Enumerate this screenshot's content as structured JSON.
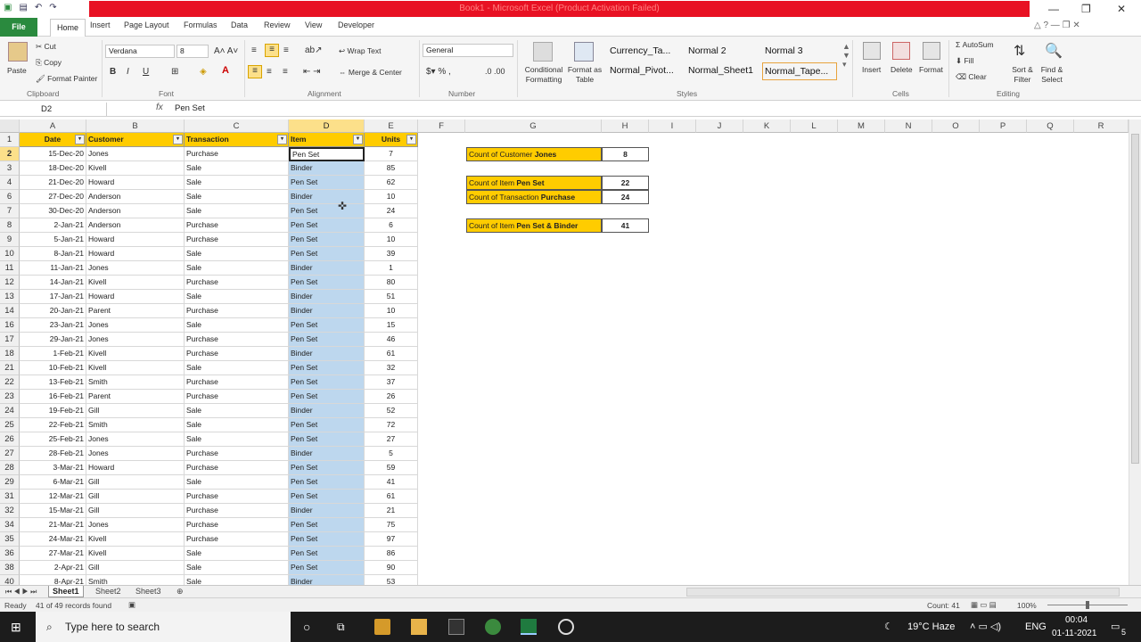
{
  "window": {
    "title": "Book1 - Microsoft Excel (Product Activation Failed)"
  },
  "ribbon_tabs": [
    "File",
    "Home",
    "Insert",
    "Page Layout",
    "Formulas",
    "Data",
    "Review",
    "View",
    "Developer"
  ],
  "clipboard": {
    "paste": "Paste",
    "cut": "Cut",
    "copy": "Copy",
    "format_painter": "Format Painter",
    "label": "Clipboard"
  },
  "font": {
    "name": "Verdana",
    "size": "8",
    "label": "Font"
  },
  "alignment": {
    "wrap": "Wrap Text",
    "merge": "Merge & Center",
    "label": "Alignment"
  },
  "number": {
    "format": "General",
    "label": "Number"
  },
  "styles": {
    "conditional": "Conditional Formatting",
    "format_table": "Format as Table",
    "items": [
      "Currency_Ta...",
      "Normal 2",
      "Normal 3",
      "Normal_Pivot...",
      "Normal_Sheet1",
      "Normal_Tape..."
    ],
    "label": "Styles"
  },
  "cells": {
    "insert": "Insert",
    "delete": "Delete",
    "format": "Format",
    "label": "Cells"
  },
  "editing": {
    "autosum": "AutoSum",
    "fill": "Fill",
    "clear": "Clear",
    "sort": "Sort & Filter",
    "find": "Find & Select",
    "label": "Editing"
  },
  "formula_bar": {
    "name_box": "D2",
    "fx": "fx",
    "content": "Pen Set"
  },
  "columns": [
    "A",
    "B",
    "C",
    "D",
    "E",
    "F",
    "G",
    "H",
    "I",
    "J",
    "K",
    "L",
    "M",
    "N",
    "O",
    "P",
    "Q",
    "R"
  ],
  "headers": {
    "date": "Date",
    "customer": "Customer",
    "transaction": "Transaction",
    "item": "Item",
    "units": "Units"
  },
  "rows": [
    {
      "n": "2",
      "date": "15-Dec-20",
      "customer": "Jones",
      "transaction": "Purchase",
      "item": "Pen Set",
      "units": "7"
    },
    {
      "n": "3",
      "date": "18-Dec-20",
      "customer": "Kivell",
      "transaction": "Sale",
      "item": "Binder",
      "units": "85"
    },
    {
      "n": "4",
      "date": "21-Dec-20",
      "customer": "Howard",
      "transaction": "Sale",
      "item": "Pen Set",
      "units": "62"
    },
    {
      "n": "6",
      "date": "27-Dec-20",
      "customer": "Anderson",
      "transaction": "Sale",
      "item": "Binder",
      "units": "10"
    },
    {
      "n": "7",
      "date": "30-Dec-20",
      "customer": "Anderson",
      "transaction": "Sale",
      "item": "Pen Set",
      "units": "24"
    },
    {
      "n": "8",
      "date": "2-Jan-21",
      "customer": "Anderson",
      "transaction": "Purchase",
      "item": "Pen Set",
      "units": "6"
    },
    {
      "n": "9",
      "date": "5-Jan-21",
      "customer": "Howard",
      "transaction": "Purchase",
      "item": "Pen Set",
      "units": "10"
    },
    {
      "n": "10",
      "date": "8-Jan-21",
      "customer": "Howard",
      "transaction": "Sale",
      "item": "Pen Set",
      "units": "39"
    },
    {
      "n": "11",
      "date": "11-Jan-21",
      "customer": "Jones",
      "transaction": "Sale",
      "item": "Binder",
      "units": "1"
    },
    {
      "n": "12",
      "date": "14-Jan-21",
      "customer": "Kivell",
      "transaction": "Purchase",
      "item": "Pen Set",
      "units": "80"
    },
    {
      "n": "13",
      "date": "17-Jan-21",
      "customer": "Howard",
      "transaction": "Sale",
      "item": "Binder",
      "units": "51"
    },
    {
      "n": "14",
      "date": "20-Jan-21",
      "customer": "Parent",
      "transaction": "Purchase",
      "item": "Binder",
      "units": "10"
    },
    {
      "n": "16",
      "date": "23-Jan-21",
      "customer": "Jones",
      "transaction": "Sale",
      "item": "Pen Set",
      "units": "15"
    },
    {
      "n": "17",
      "date": "29-Jan-21",
      "customer": "Jones",
      "transaction": "Purchase",
      "item": "Pen Set",
      "units": "46"
    },
    {
      "n": "18",
      "date": "1-Feb-21",
      "customer": "Kivell",
      "transaction": "Purchase",
      "item": "Binder",
      "units": "61"
    },
    {
      "n": "21",
      "date": "10-Feb-21",
      "customer": "Kivell",
      "transaction": "Sale",
      "item": "Pen Set",
      "units": "32"
    },
    {
      "n": "22",
      "date": "13-Feb-21",
      "customer": "Smith",
      "transaction": "Purchase",
      "item": "Pen Set",
      "units": "37"
    },
    {
      "n": "23",
      "date": "16-Feb-21",
      "customer": "Parent",
      "transaction": "Purchase",
      "item": "Pen Set",
      "units": "26"
    },
    {
      "n": "24",
      "date": "19-Feb-21",
      "customer": "Gill",
      "transaction": "Sale",
      "item": "Binder",
      "units": "52"
    },
    {
      "n": "25",
      "date": "22-Feb-21",
      "customer": "Smith",
      "transaction": "Sale",
      "item": "Pen Set",
      "units": "72"
    },
    {
      "n": "26",
      "date": "25-Feb-21",
      "customer": "Jones",
      "transaction": "Sale",
      "item": "Pen Set",
      "units": "27"
    },
    {
      "n": "27",
      "date": "28-Feb-21",
      "customer": "Jones",
      "transaction": "Purchase",
      "item": "Binder",
      "units": "5"
    },
    {
      "n": "28",
      "date": "3-Mar-21",
      "customer": "Howard",
      "transaction": "Purchase",
      "item": "Pen Set",
      "units": "59"
    },
    {
      "n": "29",
      "date": "6-Mar-21",
      "customer": "Gill",
      "transaction": "Sale",
      "item": "Pen Set",
      "units": "41"
    },
    {
      "n": "31",
      "date": "12-Mar-21",
      "customer": "Gill",
      "transaction": "Purchase",
      "item": "Pen Set",
      "units": "61"
    },
    {
      "n": "32",
      "date": "15-Mar-21",
      "customer": "Gill",
      "transaction": "Purchase",
      "item": "Binder",
      "units": "21"
    },
    {
      "n": "34",
      "date": "21-Mar-21",
      "customer": "Jones",
      "transaction": "Purchase",
      "item": "Pen Set",
      "units": "75"
    },
    {
      "n": "35",
      "date": "24-Mar-21",
      "customer": "Kivell",
      "transaction": "Purchase",
      "item": "Pen Set",
      "units": "97"
    },
    {
      "n": "36",
      "date": "27-Mar-21",
      "customer": "Kivell",
      "transaction": "Sale",
      "item": "Pen Set",
      "units": "86"
    },
    {
      "n": "38",
      "date": "2-Apr-21",
      "customer": "Gill",
      "transaction": "Sale",
      "item": "Pen Set",
      "units": "90"
    },
    {
      "n": "40",
      "date": "8-Apr-21",
      "customer": "Smith",
      "transaction": "Sale",
      "item": "Binder",
      "units": "53"
    }
  ],
  "summary": [
    {
      "label_pre": "Count of Customer ",
      "label_bold": "Jones",
      "value": "8"
    },
    {
      "label_pre": "Count of Item ",
      "label_bold": "Pen Set",
      "value": "22"
    },
    {
      "label_pre": "Count of Transaction ",
      "label_bold": "Purchase",
      "value": "24"
    },
    {
      "label_pre": "Count of Item ",
      "label_bold": "Pen Set & Binder",
      "value": "41"
    }
  ],
  "sheets": [
    "Sheet1",
    "Sheet2",
    "Sheet3"
  ],
  "status": {
    "mode": "Ready",
    "records": "41 of 49 records found",
    "count": "Count: 41",
    "zoom": "100%"
  },
  "taskbar": {
    "search": "Type here to search",
    "weather": "19°C Haze",
    "lang": "ENG",
    "time": "00:04",
    "date": "01-11-2021",
    "notif": "5"
  }
}
